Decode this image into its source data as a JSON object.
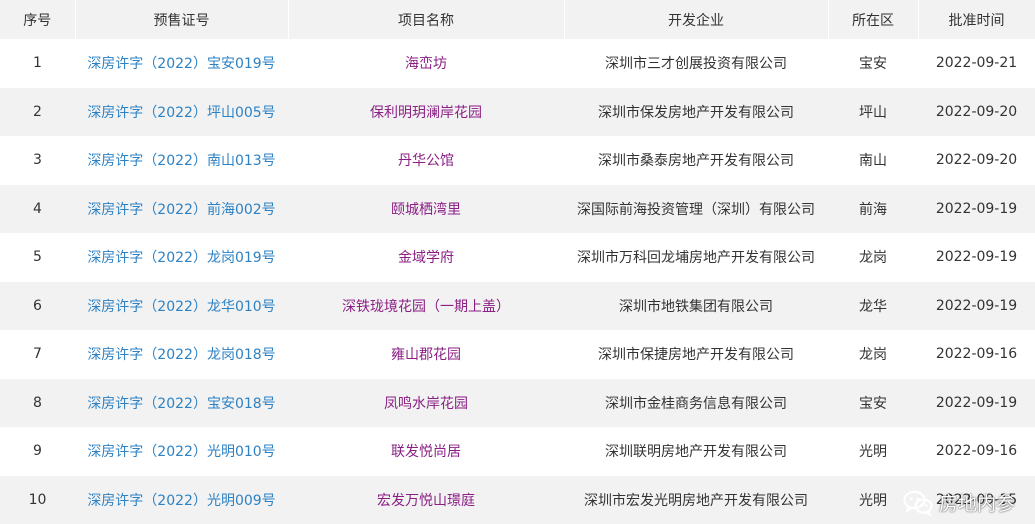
{
  "table": {
    "headers": [
      "序号",
      "预售证号",
      "项目名称",
      "开发企业",
      "所在区",
      "批准时间"
    ],
    "rows": [
      {
        "no": "1",
        "cert": "深房许字（2022）宝安019号",
        "project": "海峦坊",
        "developer": "深圳市三才创展投资有限公司",
        "district": "宝安",
        "date": "2022-09-21"
      },
      {
        "no": "2",
        "cert": "深房许字（2022）坪山005号",
        "project": "保利明玥澜岸花园",
        "developer": "深圳市保发房地产开发有限公司",
        "district": "坪山",
        "date": "2022-09-20"
      },
      {
        "no": "3",
        "cert": "深房许字（2022）南山013号",
        "project": "丹华公馆",
        "developer": "深圳市桑泰房地产开发有限公司",
        "district": "南山",
        "date": "2022-09-20"
      },
      {
        "no": "4",
        "cert": "深房许字（2022）前海002号",
        "project": "颐城栖湾里",
        "developer": "深国际前海投资管理（深圳）有限公司",
        "district": "前海",
        "date": "2022-09-19"
      },
      {
        "no": "5",
        "cert": "深房许字（2022）龙岗019号",
        "project": "金域学府",
        "developer": "深圳市万科回龙埔房地产开发有限公司",
        "district": "龙岗",
        "date": "2022-09-19"
      },
      {
        "no": "6",
        "cert": "深房许字（2022）龙华010号",
        "project": "深铁珑境花园（一期上盖）",
        "developer": "深圳市地铁集团有限公司",
        "district": "龙华",
        "date": "2022-09-19"
      },
      {
        "no": "7",
        "cert": "深房许字（2022）龙岗018号",
        "project": "雍山郡花园",
        "developer": "深圳市保捷房地产开发有限公司",
        "district": "龙岗",
        "date": "2022-09-16"
      },
      {
        "no": "8",
        "cert": "深房许字（2022）宝安018号",
        "project": "凤鸣水岸花园",
        "developer": "深圳市金桂商务信息有限公司",
        "district": "宝安",
        "date": "2022-09-19"
      },
      {
        "no": "9",
        "cert": "深房许字（2022）光明010号",
        "project": "联发悦尚居",
        "developer": "深圳联明房地产开发有限公司",
        "district": "光明",
        "date": "2022-09-16"
      },
      {
        "no": "10",
        "cert": "深房许字（2022）光明009号",
        "project": "宏发万悦山璟庭",
        "developer": "深圳市宏发光明房地产开发有限公司",
        "district": "光明",
        "date": "2022-09-15"
      }
    ]
  },
  "watermark": {
    "text": "房地内参",
    "icon": "wechat-icon"
  },
  "colors": {
    "header_bg": "#f2f2f2",
    "stripe_bg": "#f2f2f2",
    "cert_link": "#2d82c4",
    "project_link": "#8b1f85",
    "text": "#333333"
  }
}
